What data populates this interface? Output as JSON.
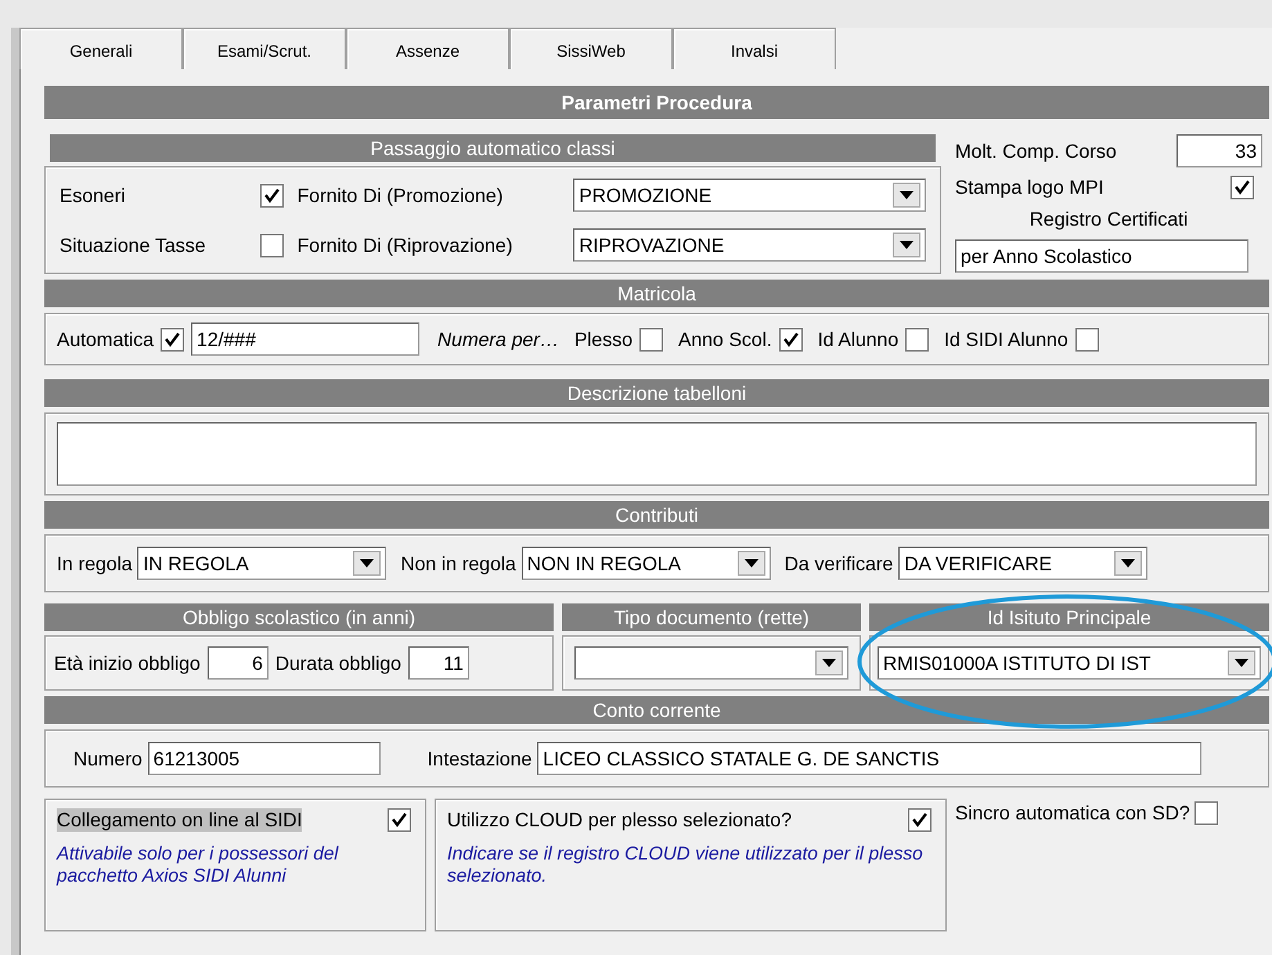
{
  "tabs": [
    {
      "label": "Generali"
    },
    {
      "label": "Esami/Scrut."
    },
    {
      "label": "Assenze"
    },
    {
      "label": "SissiWeb"
    },
    {
      "label": "Invalsi"
    }
  ],
  "title": "Parametri Procedura",
  "passaggio": {
    "header": "Passaggio automatico classi",
    "rows": [
      {
        "label": "Esoneri",
        "checked": true,
        "select_label": "Fornito Di (Promozione)",
        "value": "PROMOZIONE"
      },
      {
        "label": "Situazione Tasse",
        "checked": false,
        "select_label": "Fornito Di (Riprovazione)",
        "value": "RIPROVAZIONE"
      }
    ]
  },
  "right_panel": {
    "molt_label": "Molt. Comp. Corso",
    "molt_value": "33",
    "stampa_label": "Stampa logo MPI",
    "stampa_checked": true,
    "registro_label": "Registro Certificati",
    "registro_value": "per Anno Scolastico"
  },
  "matricola": {
    "header": "Matricola",
    "automatica_label": "Automatica",
    "automatica_checked": true,
    "value": "12/###",
    "numera_label": "Numera per…",
    "options": [
      {
        "label": "Plesso",
        "checked": false
      },
      {
        "label": "Anno Scol.",
        "checked": true
      },
      {
        "label": "Id Alunno",
        "checked": false
      },
      {
        "label": "Id SIDI Alunno",
        "checked": false
      }
    ]
  },
  "descrizione": {
    "header": "Descrizione tabelloni"
  },
  "contributi": {
    "header": "Contributi",
    "fields": [
      {
        "label": "In regola",
        "value": "IN REGOLA"
      },
      {
        "label": "Non in regola",
        "value": "NON IN REGOLA"
      },
      {
        "label": "Da verificare",
        "value": "DA VERIFICARE"
      }
    ]
  },
  "obbligo": {
    "header": "Obbligo scolastico (in anni)",
    "eta_label": "Età inizio obbligo",
    "eta_value": "6",
    "durata_label": "Durata obbligo",
    "durata_value": "11"
  },
  "tipo_documento": {
    "header": "Tipo documento (rette)"
  },
  "id_istituto": {
    "header": "Id Isituto Principale",
    "value": "RMIS01000A ISTITUTO DI IST",
    "circled": true
  },
  "conto": {
    "header": "Conto corrente",
    "numero_label": "Numero",
    "numero_value": "61213005",
    "intestazione_label": "Intestazione",
    "intestazione_value": "LICEO CLASSICO STATALE G. DE SANCTIS"
  },
  "options": [
    {
      "label": "Collegamento on line al SIDI",
      "checked": true,
      "focused": true,
      "note": "Attivabile solo per i possessori del pacchetto Axios SIDI Alunni"
    },
    {
      "label": "Utilizzo CLOUD per plesso selezionato?",
      "checked": true,
      "focused": false,
      "note": "Indicare se il registro CLOUD viene utilizzato per il plesso selezionato."
    }
  ],
  "sincro": {
    "label": "Sincro automatica con SD?",
    "checked": false
  }
}
